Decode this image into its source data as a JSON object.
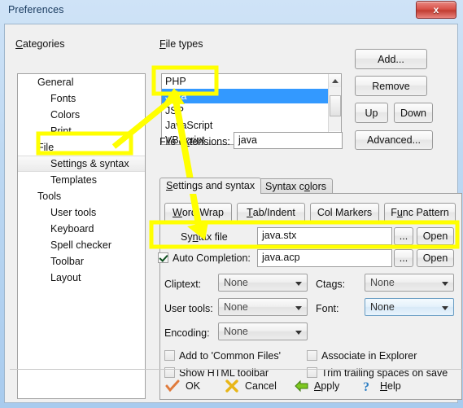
{
  "window": {
    "title": "Preferences",
    "close_label": "x"
  },
  "categories": {
    "label": "Categories",
    "items": [
      {
        "label": "General",
        "level": 0,
        "selected": false
      },
      {
        "label": "Fonts",
        "level": 1,
        "selected": false
      },
      {
        "label": "Colors",
        "level": 1,
        "selected": false
      },
      {
        "label": "Print",
        "level": 1,
        "selected": false
      },
      {
        "label": "File",
        "level": 0,
        "selected": false
      },
      {
        "label": "Settings & syntax",
        "level": 1,
        "selected": true
      },
      {
        "label": "Templates",
        "level": 1,
        "selected": false
      },
      {
        "label": "Tools",
        "level": 0,
        "selected": false
      },
      {
        "label": "User tools",
        "level": 1,
        "selected": false
      },
      {
        "label": "Keyboard",
        "level": 1,
        "selected": false
      },
      {
        "label": "Spell checker",
        "level": 1,
        "selected": false
      },
      {
        "label": "Toolbar",
        "level": 1,
        "selected": false
      },
      {
        "label": "Layout",
        "level": 1,
        "selected": false
      }
    ]
  },
  "file_types": {
    "label": "File types",
    "items": [
      {
        "label": "PHP",
        "selected": false
      },
      {
        "label": "Java",
        "selected": true
      },
      {
        "label": "JSP",
        "selected": false
      },
      {
        "label": "JavaScript",
        "selected": false
      },
      {
        "label": "VBScript",
        "selected": false
      }
    ],
    "buttons": {
      "add": "Add...",
      "remove": "Remove",
      "up": "Up",
      "down": "Down",
      "advanced": "Advanced..."
    }
  },
  "file_extensions": {
    "label": "File extensions:",
    "value": "java"
  },
  "tabs": [
    {
      "label": "Settings and syntax",
      "active": true
    },
    {
      "label": "Syntax colors",
      "active": false
    }
  ],
  "panel": {
    "buttons": {
      "word_wrap": "Word Wrap",
      "tab_indent": "Tab/Indent",
      "col_markers": "Col Markers",
      "func_pattern": "Func Pattern"
    },
    "syntax_file": {
      "label": "Syntax file",
      "value": "java.stx",
      "browse": "...",
      "open": "Open"
    },
    "auto_completion": {
      "label": "Auto Completion:",
      "checked": true,
      "value": "java.acp",
      "browse": "...",
      "open": "Open"
    },
    "combos": [
      {
        "label": "Cliptext:",
        "value": "None",
        "focused": false
      },
      {
        "label": "Ctags:",
        "value": "None",
        "focused": false
      },
      {
        "label": "User tools:",
        "value": "None",
        "focused": false
      },
      {
        "label": "Font:",
        "value": "None",
        "focused": true
      },
      {
        "label": "Encoding:",
        "value": "None",
        "focused": false
      }
    ],
    "checkboxes": [
      {
        "label": "Add to 'Common Files'",
        "checked": false
      },
      {
        "label": "Associate in Explorer",
        "checked": false
      },
      {
        "label": "Show HTML toolbar",
        "checked": false
      },
      {
        "label": "Trim trailing spaces on save",
        "checked": false
      }
    ]
  },
  "footer": {
    "ok": "OK",
    "cancel": "Cancel",
    "apply": "Apply",
    "help": "Help"
  },
  "colors": {
    "selection_blue": "#3399ff",
    "annotation_yellow": "#ffff00",
    "close_red": "#c23d32"
  }
}
